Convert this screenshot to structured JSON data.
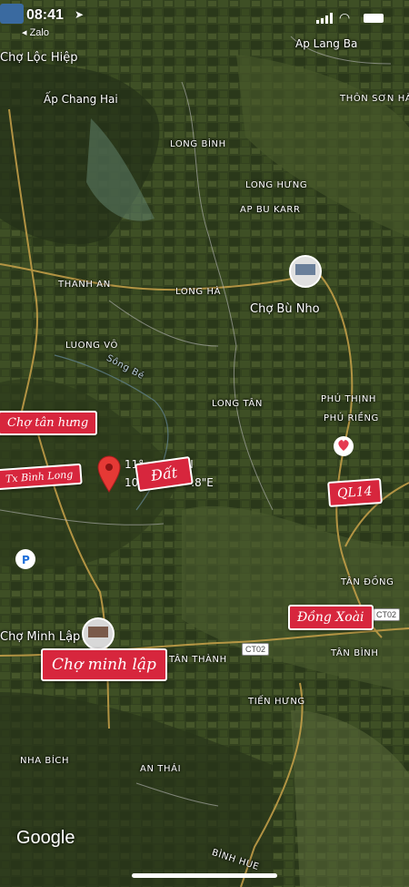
{
  "status_bar": {
    "time": "08:41",
    "back_app": "Zalo"
  },
  "map": {
    "places": [
      {
        "key": "cho-loc-hiep",
        "label": "Chợ Lộc Hiệp"
      },
      {
        "key": "ap-chang-hai",
        "label": "Ấp Chang Hai"
      },
      {
        "key": "ap-lang-ba",
        "label": "Ap Lang Ba"
      },
      {
        "key": "thon-son-ha",
        "label": "THÔN SƠN HÀ"
      },
      {
        "key": "long-binh",
        "label": "LONG BÌNH"
      },
      {
        "key": "long-hung",
        "label": "LONG HƯNG"
      },
      {
        "key": "ap-bu-karr",
        "label": "AP BU KARR"
      },
      {
        "key": "thanh-an",
        "label": "THANH AN"
      },
      {
        "key": "long-ha",
        "label": "LONG HÀ"
      },
      {
        "key": "cho-bu-nho",
        "label": "Chợ Bù Nho"
      },
      {
        "key": "luong-vo",
        "label": "LUONG VÔ"
      },
      {
        "key": "song-be",
        "label": "Sông Bé"
      },
      {
        "key": "long-tan",
        "label": "LONG TÂN"
      },
      {
        "key": "phu-thinh",
        "label": "PHÚ THỊNH"
      },
      {
        "key": "phu-rieng",
        "label": "PHÚ RIỀNG"
      },
      {
        "key": "tan-dong",
        "label": "TÂN ĐỒNG"
      },
      {
        "key": "cho-minh-lap",
        "label": "Chợ Minh Lập"
      },
      {
        "key": "tan-thanh",
        "label": "TÂN THÀNH"
      },
      {
        "key": "tan-binh",
        "label": "TÂN BÌNH"
      },
      {
        "key": "tien-hung",
        "label": "TIẾN HƯNG"
      },
      {
        "key": "nha-bich",
        "label": "NHA BÍCH"
      },
      {
        "key": "an-thai",
        "label": "AN THÁI"
      },
      {
        "key": "binh-hue",
        "label": "BÌNH HUE"
      }
    ],
    "routes": [
      "CT02",
      "CT02"
    ],
    "pin_coord_line1": "11°",
    "pin_coord_line1_end": "\"N",
    "pin_coord_line2": "10",
    "pin_coord_line2_end": ".8\"E",
    "stickers": {
      "cho_tan_hung": "Chợ tân hưng",
      "tx_binh_long": "Tx Bình Long",
      "dat": "Đất",
      "ql14": "QL14",
      "dong_xoai": "Đồng Xoài",
      "cho_minh_lap": "Chợ minh lập"
    },
    "attribution": "Google"
  },
  "colors": {
    "sticker": "#d7263d",
    "pin": "#e53935"
  }
}
